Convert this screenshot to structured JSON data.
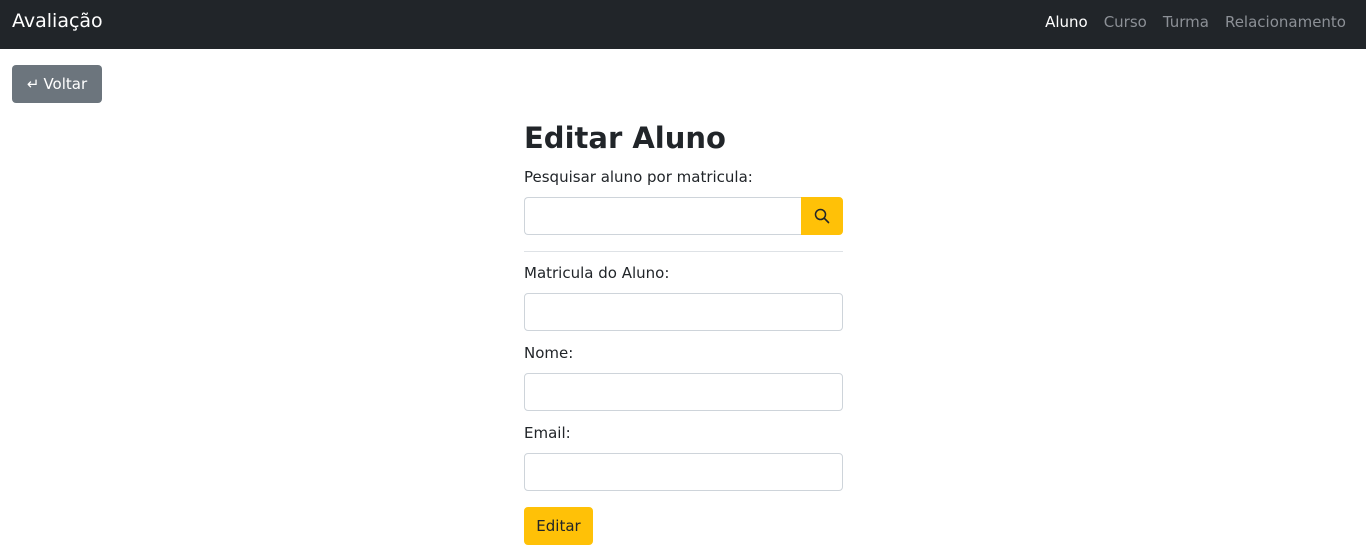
{
  "navbar": {
    "brand": "Avaliação",
    "links": [
      {
        "label": "Aluno",
        "active": true
      },
      {
        "label": "Curso",
        "active": false
      },
      {
        "label": "Turma",
        "active": false
      },
      {
        "label": "Relacionamento",
        "active": false
      }
    ]
  },
  "back_button": {
    "label": "Voltar",
    "icon": "return-arrow-icon"
  },
  "form": {
    "title": "Editar Aluno",
    "search": {
      "label": "Pesquisar aluno por matricula:",
      "value": "",
      "button_icon": "search-icon"
    },
    "fields": {
      "matricula": {
        "label": "Matricula do Aluno:",
        "value": ""
      },
      "nome": {
        "label": "Nome:",
        "value": ""
      },
      "email": {
        "label": "Email:",
        "value": ""
      }
    },
    "submit_label": "Editar"
  },
  "colors": {
    "navbar_bg": "#212529",
    "accent": "#ffc107",
    "secondary": "#6c757d"
  }
}
